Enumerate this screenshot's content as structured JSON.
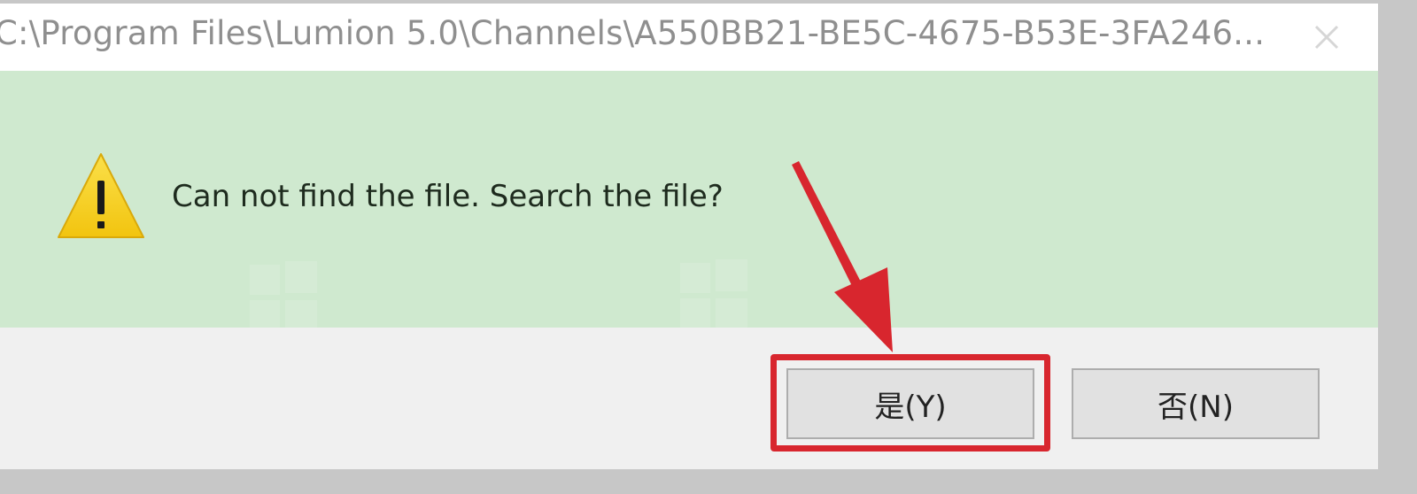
{
  "dialog": {
    "title": "C:\\Program Files\\Lumion 5.0\\Channels\\A550BB21-BE5C-4675-B53E-3FA246...",
    "message": "Can not find the file. Search the file?",
    "buttons": {
      "yes_label": "是(Y)",
      "no_label": "否(N)"
    },
    "icons": {
      "warning": "warning-icon",
      "close": "close-icon"
    }
  },
  "annotation": {
    "highlight_color": "#d8262e",
    "arrow_color": "#d8262e"
  },
  "colors": {
    "content_bg": "#cfe9cf",
    "footer_bg": "#f0f0f0",
    "warning_yellow": "#f7d21c"
  }
}
